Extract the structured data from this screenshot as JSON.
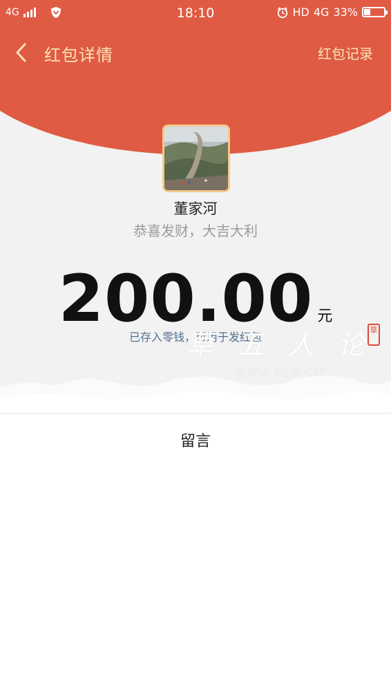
{
  "status_bar": {
    "network": "4G",
    "time": "18:10",
    "hd": "HD",
    "network2": "4G",
    "battery_text": "33%",
    "battery_level": 0.33
  },
  "nav": {
    "title": "红包详情",
    "record_link": "红包记录"
  },
  "sender": {
    "name": "董家河",
    "wishing": "恭喜发财，大吉大利"
  },
  "amount": {
    "value": "200.00",
    "currency": "元"
  },
  "deposit_note": "已存入零钱，可用于发红包",
  "message_label": "留言",
  "watermark": {
    "text": "草 五 人 论 坛",
    "url": "WWW.ZAR.CN",
    "seal": "草"
  },
  "colors": {
    "header_red": "#df5b44",
    "title_gold": "#fbe3b6",
    "link_blue": "#55708f"
  }
}
